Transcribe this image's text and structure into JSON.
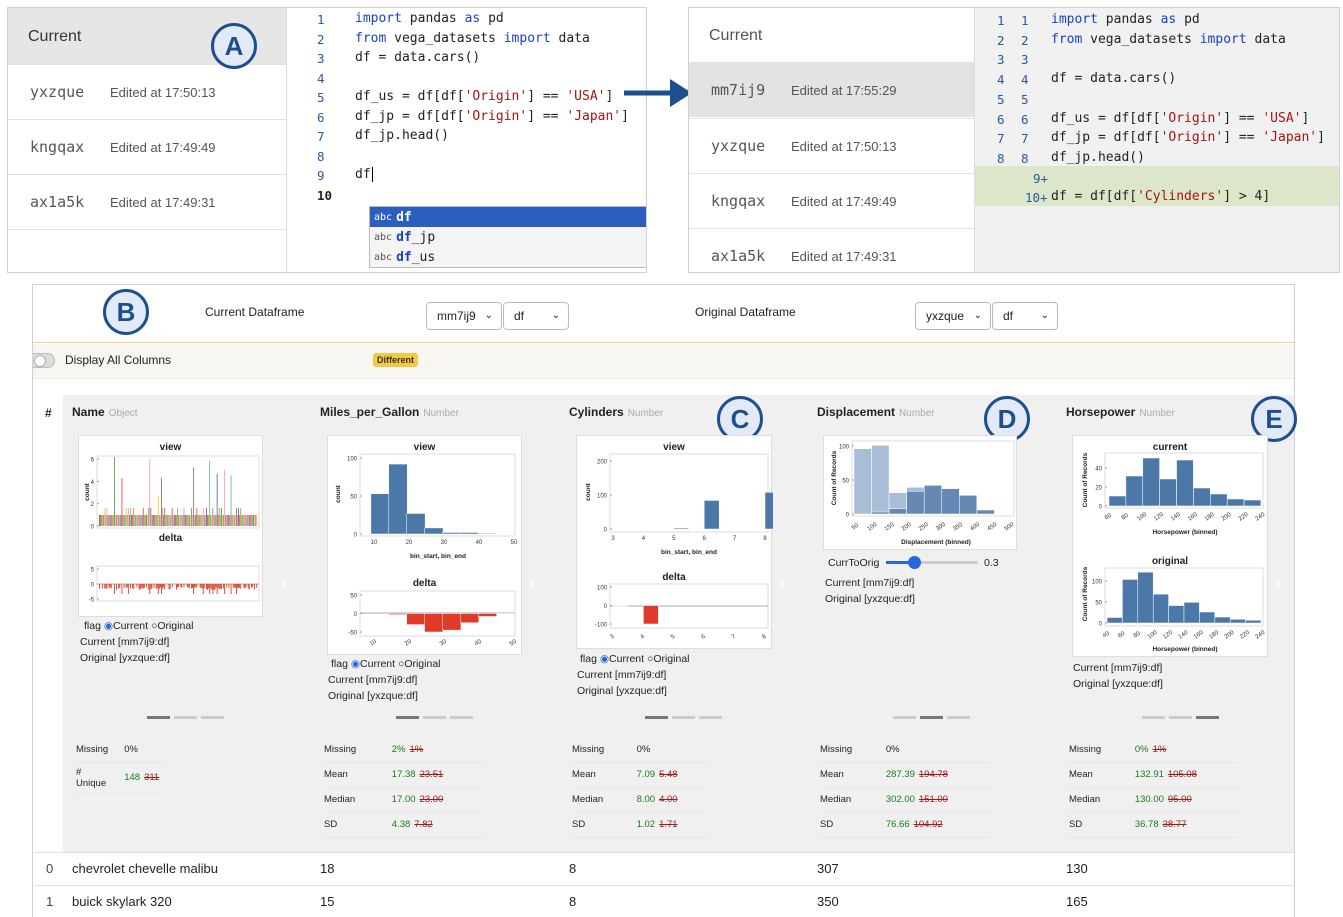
{
  "left_panel": {
    "history_header": "Current",
    "history": [
      {
        "id": "yxzque",
        "time": "Edited at 17:50:13"
      },
      {
        "id": "kngqax",
        "time": "Edited at 17:49:49"
      },
      {
        "id": "ax1a5k",
        "time": "Edited at 17:49:31"
      }
    ],
    "line_numbers": [
      "1",
      "2",
      "3",
      "4",
      "5",
      "6",
      "7",
      "8",
      "9",
      "10"
    ],
    "code_lines": [
      "import pandas as pd",
      "from vega_datasets import data",
      "",
      "df = data.cars()",
      "",
      "df_us = df[df['Origin'] == 'USA']",
      "df_jp = df[df['Origin'] == 'Japan']",
      "df_jp.head()",
      "",
      "df"
    ],
    "autocomplete": [
      {
        "tag": "abc",
        "bold": "df",
        "rest": ""
      },
      {
        "tag": "abc",
        "bold": "df",
        "rest": "_jp"
      },
      {
        "tag": "abc",
        "bold": "df",
        "rest": "_us"
      }
    ]
  },
  "right_panel": {
    "history_header": "Current",
    "history": [
      {
        "id": "mm7ij9",
        "time": "Edited at 17:55:29"
      },
      {
        "id": "yxzque",
        "time": "Edited at 17:50:13"
      },
      {
        "id": "kngqax",
        "time": "Edited at 17:49:49"
      },
      {
        "id": "ax1a5k",
        "time": "Edited at 17:49:31"
      }
    ],
    "old_line_numbers": [
      "1",
      "2",
      "3",
      "4",
      "5",
      "6",
      "7",
      "8"
    ],
    "new_line_numbers": [
      "1",
      "2",
      "3",
      "4",
      "5",
      "6",
      "7",
      "8",
      "9+",
      "10+"
    ],
    "added_line": "df = df[df['Cylinders'] > 4]"
  },
  "markers": {
    "a": "A",
    "b": "B",
    "c": "C",
    "d": "D",
    "e": "E"
  },
  "toolbar": {
    "current_label": "Current Dataframe",
    "current_snapshot": "mm7ij9",
    "current_var": "df",
    "original_label": "Original Dataframe",
    "original_snapshot": "yxzque",
    "original_var": "df",
    "toggle_label": "Display All Columns",
    "badge": "Different"
  },
  "table": {
    "index_header": "#",
    "columns": [
      {
        "name": "Name",
        "type": "Object"
      },
      {
        "name": "Miles_per_Gallon",
        "type": "Number"
      },
      {
        "name": "Cylinders",
        "type": "Number"
      },
      {
        "name": "Displacement",
        "type": "Number"
      },
      {
        "name": "Horsepower",
        "type": "Number"
      }
    ],
    "rows": [
      {
        "idx": "0",
        "cells": [
          "chevrolet chevelle malibu",
          "18",
          "8",
          "307",
          "130"
        ]
      },
      {
        "idx": "1",
        "cells": [
          "buick skylark 320",
          "15",
          "8",
          "350",
          "165"
        ]
      }
    ]
  },
  "cards": {
    "name": {
      "title_top": "view",
      "title_bottom": "delta",
      "ylabel": "count",
      "yticks": [
        "6",
        "4",
        "2",
        "0"
      ],
      "dticks": [
        "5",
        "0",
        "-5"
      ]
    },
    "mpg": {
      "title_top": "view",
      "title_bottom": "delta",
      "ylabel": "count",
      "xlabel": "bin_start, bin_end",
      "yticks": [
        "100",
        "50",
        "0"
      ],
      "xticks": [
        "10",
        "20",
        "30",
        "40",
        "50"
      ],
      "dticks": [
        "50",
        "0",
        "-50"
      ]
    },
    "cyl": {
      "title_top": "view",
      "title_bottom": "delta",
      "ylabel": "count",
      "xlabel": "bin_start, bin_end",
      "yticks": [
        "200",
        "100",
        "0"
      ],
      "xticks": [
        "3",
        "4",
        "5",
        "6",
        "7",
        "8"
      ],
      "dticks": [
        "100",
        "0",
        "-100"
      ]
    },
    "disp": {
      "ylabel": "Count of Records",
      "xlabel": "Displacement (binned)",
      "yticks": [
        "100",
        "50",
        "0"
      ],
      "xticks": [
        "50",
        "100",
        "150",
        "200",
        "250",
        "300",
        "350",
        "400",
        "450",
        "500"
      ],
      "slider_label": "CurrToOrig",
      "slider_value": "0.3"
    },
    "hp": {
      "title_top": "current",
      "title_bottom": "original",
      "ylabel": "Count of Records",
      "xlabel": "Horsepower (binned)",
      "yticks_top": [
        "40",
        "20",
        "0"
      ],
      "yticks_bottom": [
        "100",
        "50",
        "0"
      ],
      "xticks": [
        "60",
        "80",
        "100",
        "120",
        "140",
        "160",
        "180",
        "200",
        "220",
        "240"
      ],
      "xticks_bottom": [
        "40",
        "60",
        "80",
        "100",
        "120",
        "140",
        "160",
        "180",
        "200",
        "220",
        "240"
      ]
    }
  },
  "flag": {
    "label": "flag",
    "current": "Current",
    "original": "Original"
  },
  "info": {
    "current": "Current [mm7ij9:df]",
    "original": "Original [yxzque:df]"
  },
  "stats": {
    "name": [
      [
        "Missing",
        "0%",
        ""
      ],
      [
        "# Unique",
        "148",
        "311"
      ]
    ],
    "mpg": [
      [
        "Missing",
        "2%",
        "1%"
      ],
      [
        "Mean",
        "17.38",
        "23.51"
      ],
      [
        "Median",
        "17.00",
        "23.00"
      ],
      [
        "SD",
        "4.38",
        "7.82"
      ]
    ],
    "cyl": [
      [
        "Missing",
        "0%",
        ""
      ],
      [
        "Mean",
        "7.09",
        "5.48"
      ],
      [
        "Median",
        "8.00",
        "4.00"
      ],
      [
        "SD",
        "1.02",
        "1.71"
      ]
    ],
    "disp": [
      [
        "Missing",
        "0%",
        ""
      ],
      [
        "Mean",
        "287.39",
        "194.78"
      ],
      [
        "Median",
        "302.00",
        "151.00"
      ],
      [
        "SD",
        "76.66",
        "104.92"
      ]
    ],
    "hp": [
      [
        "Missing",
        "0%",
        "1%"
      ],
      [
        "Mean",
        "132.91",
        "105.08"
      ],
      [
        "Median",
        "130.00",
        "95.00"
      ],
      [
        "SD",
        "36.78",
        "38.77"
      ]
    ]
  },
  "chart_data": [
    {
      "type": "bar",
      "title": "view",
      "xlabel": "bin_start, bin_end",
      "ylabel": "count",
      "x": [
        10,
        15,
        20,
        25,
        30,
        35,
        40,
        45
      ],
      "values": [
        53,
        92,
        27,
        8,
        2,
        2,
        1,
        0
      ],
      "ylim": [
        0,
        100
      ]
    },
    {
      "type": "bar",
      "title": "delta",
      "x": [
        15,
        20,
        25,
        30,
        35,
        40,
        45
      ],
      "values": [
        -3,
        -30,
        -55,
        -45,
        -25,
        -8,
        -1
      ],
      "ylim": [
        -50,
        50
      ]
    },
    {
      "type": "bar",
      "title": "view",
      "xlabel": "bin_start, bin_end",
      "ylabel": "count",
      "x": [
        5,
        6,
        8
      ],
      "values": [
        3,
        84,
        108
      ],
      "ylim": [
        0,
        200
      ]
    },
    {
      "type": "bar",
      "title": "delta",
      "x": [
        3,
        4
      ],
      "values": [
        -3,
        -204
      ],
      "ylim": [
        -100,
        100
      ]
    },
    {
      "type": "bar",
      "xlabel": "Displacement (binned)",
      "ylabel": "Count of Records",
      "x": [
        50,
        100,
        150,
        200,
        250,
        300,
        350,
        400,
        450
      ],
      "series": [
        {
          "values": [
            0,
            3,
            8,
            34,
            43,
            38,
            28,
            6,
            0
          ]
        },
        {
          "values": [
            98,
            103,
            32,
            40,
            42,
            38,
            28,
            6,
            0
          ]
        }
      ],
      "ylim": [
        0,
        100
      ]
    },
    {
      "type": "bar",
      "title": "current",
      "xlabel": "Horsepower (binned)",
      "ylabel": "Count of Records",
      "x": [
        60,
        80,
        100,
        120,
        140,
        160,
        180,
        200,
        220
      ],
      "values": [
        10,
        30,
        48,
        27,
        46,
        18,
        12,
        7,
        6
      ],
      "ylim": [
        0,
        50
      ]
    },
    {
      "type": "bar",
      "title": "original",
      "xlabel": "Horsepower (binned)",
      "ylabel": "Count of Records",
      "x": [
        40,
        60,
        80,
        100,
        120,
        140,
        160,
        180,
        200,
        220
      ],
      "values": [
        12,
        95,
        111,
        63,
        38,
        45,
        24,
        13,
        8,
        6
      ],
      "ylim": [
        0,
        120
      ]
    }
  ]
}
